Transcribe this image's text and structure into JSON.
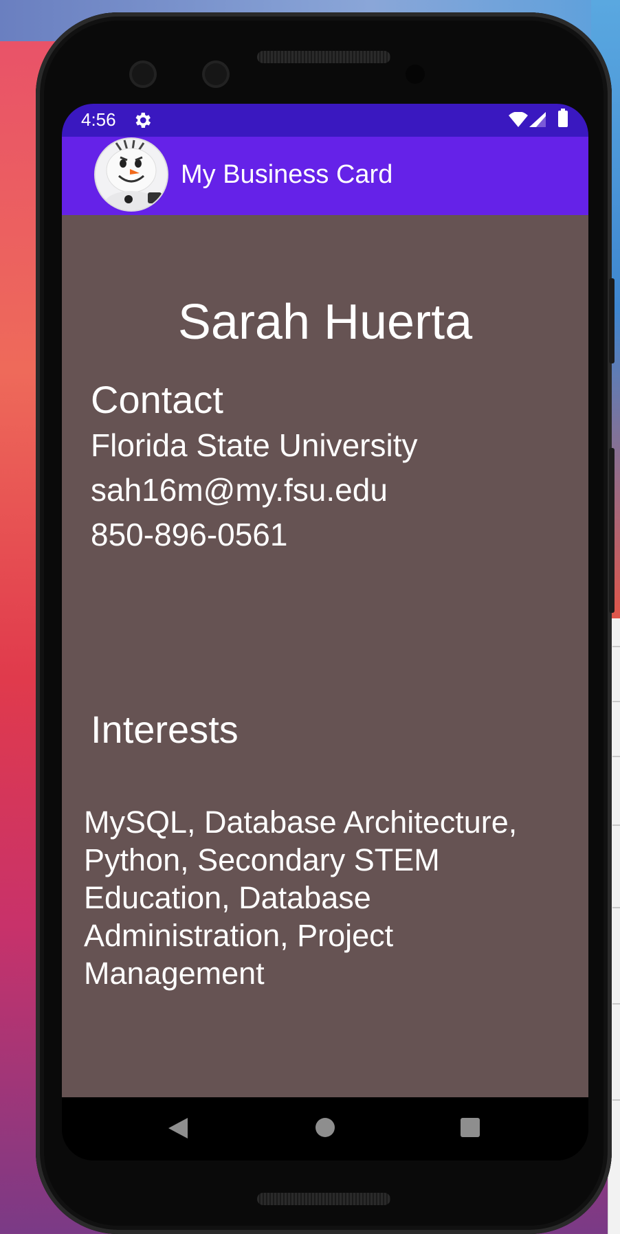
{
  "status_bar": {
    "time": "4:56",
    "icons": [
      "settings-icon",
      "wifi-icon",
      "signal-icon",
      "battery-icon"
    ]
  },
  "app_bar": {
    "title": "My Business Card",
    "avatar": "snowman-avatar",
    "color": "#6522e8"
  },
  "card": {
    "name": "Sarah Huerta",
    "contact_heading": "Contact",
    "contact_lines": [
      "Florida State University",
      "sah16m@my.fsu.edu",
      "850-896-0561"
    ],
    "interests_heading": "Interests",
    "interests_text": "MySQL, Database Architecture, Python, Secondary STEM Education, Database Administration, Project Management",
    "background_color": "#665353"
  },
  "nav_bar": {
    "buttons": [
      "back-icon",
      "home-icon",
      "recents-icon"
    ]
  },
  "colors": {
    "status_bar": "#3a18c0",
    "text": "#ffffff"
  }
}
